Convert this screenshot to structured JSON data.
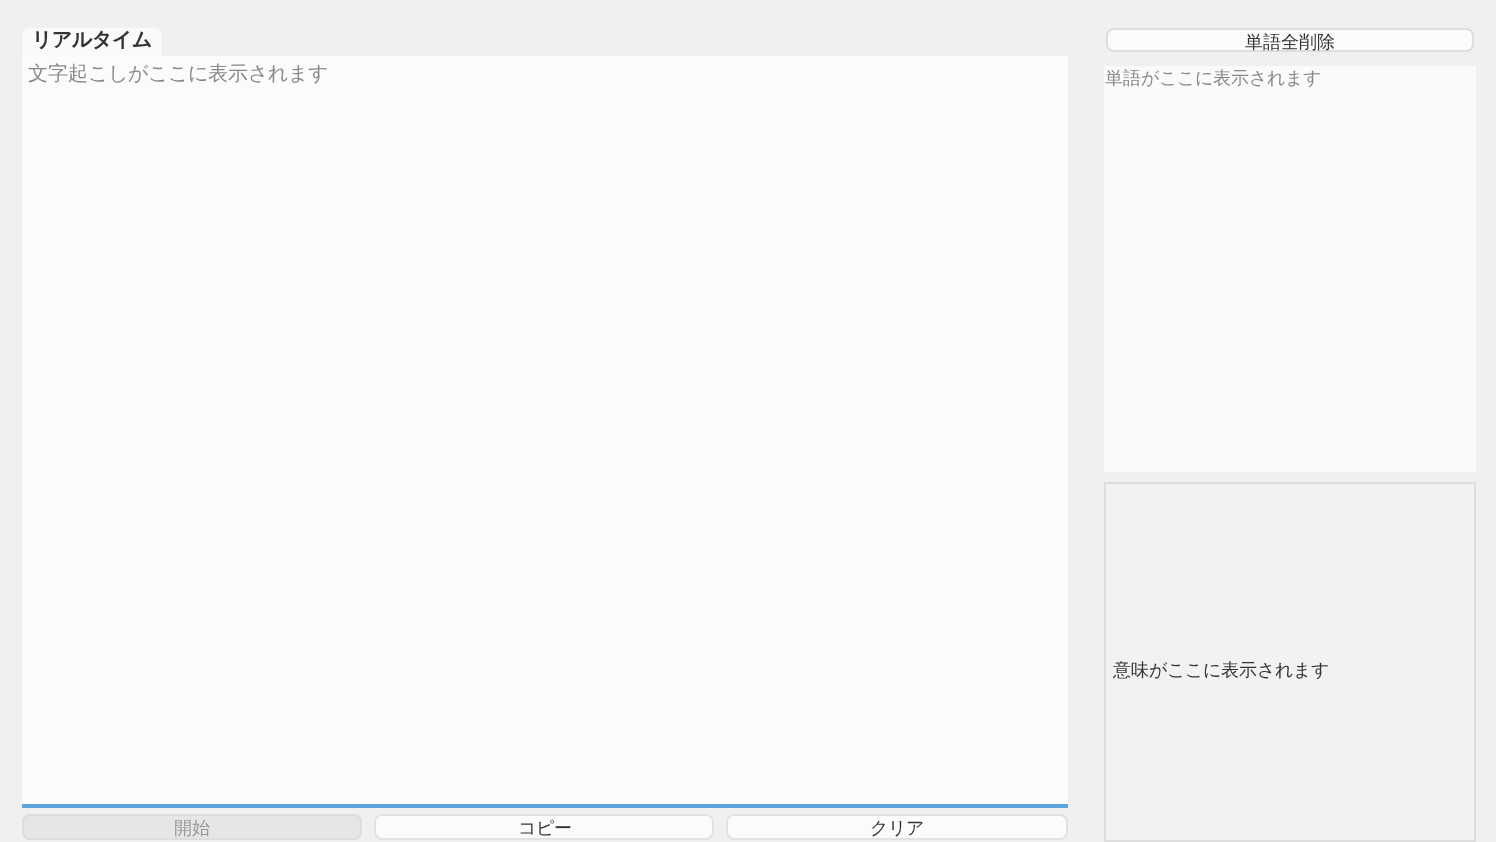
{
  "realtime": {
    "tab_label": "リアルタイム",
    "placeholder": "文字起こしがここに表示されます"
  },
  "buttons": [
    {
      "label": "開始",
      "disabled": true
    },
    {
      "label": "コピー",
      "disabled": false
    },
    {
      "label": "クリア",
      "disabled": false
    }
  ],
  "words": {
    "clear_button": "単語全削除",
    "placeholder": "単語がここに表示されます"
  },
  "meaning": {
    "placeholder": "意味がここに表示されます"
  }
}
